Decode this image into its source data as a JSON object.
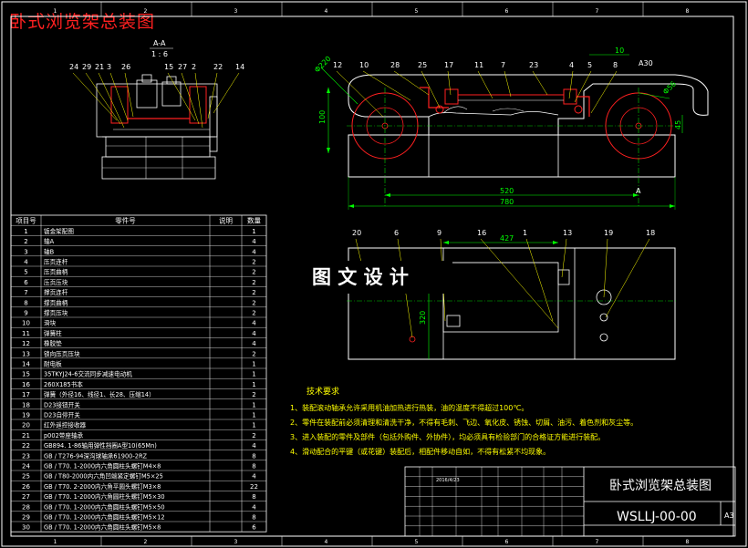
{
  "header_title": "卧式浏览架总装图",
  "border_zones_top": [
    "1",
    "2",
    "3",
    "4",
    "5",
    "6",
    "7",
    "8"
  ],
  "section_label": "A-A",
  "section_scale": "1 : 6",
  "left_callouts": [
    "24",
    "29",
    "21",
    "3",
    "26",
    "15",
    "27",
    "2",
    "22",
    "14"
  ],
  "top_callouts": [
    "12",
    "10",
    "28",
    "25",
    "17",
    "11",
    "7",
    "23",
    "4",
    "5",
    "8"
  ],
  "view_label_a": "A",
  "view_label_a30": "A30",
  "dims_top": {
    "d220": "Φ220",
    "d100": "100",
    "d10": "10",
    "d56": "Φ56",
    "d45": "45",
    "d520": "520",
    "d780": "780"
  },
  "bottom_callouts": [
    "20",
    "6",
    "9",
    "16",
    "1",
    "13",
    "19",
    "18"
  ],
  "dims_bottom": {
    "d427": "427",
    "d320": "320"
  },
  "watermark": "图 文 设 计",
  "bom_header": [
    "项目号",
    "零件号",
    "说明",
    "数量"
  ],
  "bom_rows": [
    [
      "1",
      "钣金架配图",
      "",
      "1"
    ],
    [
      "2",
      "轴A",
      "",
      "4"
    ],
    [
      "3",
      "轴B",
      "",
      "4"
    ],
    [
      "4",
      "压页连杆",
      "",
      "2"
    ],
    [
      "5",
      "压页曲柄",
      "",
      "2"
    ],
    [
      "6",
      "压页压块",
      "",
      "2"
    ],
    [
      "7",
      "撑页连杆",
      "",
      "2"
    ],
    [
      "8",
      "撑页曲柄",
      "",
      "2"
    ],
    [
      "9",
      "撑页压块",
      "",
      "2"
    ],
    [
      "10",
      "滑块",
      "",
      "4"
    ],
    [
      "11",
      "弹簧柱",
      "",
      "4"
    ],
    [
      "12",
      "橡胶垫",
      "",
      "4"
    ],
    [
      "13",
      "锁向压页压块",
      "",
      "2"
    ],
    [
      "14",
      "耐电板",
      "",
      "1"
    ],
    [
      "15",
      "35TKYJ24-6交流同步减速电动机",
      "",
      "1"
    ],
    [
      "16",
      "260X185书本",
      "",
      "1"
    ],
    [
      "17",
      "弹簧（外径16、线径1、长28、压缩14）",
      "",
      "2"
    ],
    [
      "18",
      "D23接钮开关",
      "",
      "1"
    ],
    [
      "19",
      "D23自停开关",
      "",
      "1"
    ],
    [
      "20",
      "红外遥控接收器",
      "",
      "1"
    ],
    [
      "21",
      "p002带座轴承",
      "",
      "2"
    ],
    [
      "22",
      "GB894. 1-86轴用弹性挡圈A型10(65Mn)",
      "",
      "4"
    ],
    [
      "23",
      "GB / T276-94深沟球轴承61900-2RZ",
      "",
      "8"
    ],
    [
      "24",
      "GB / T70. 1-2000内六角圆柱头螺钉M4×8",
      "",
      "8"
    ],
    [
      "25",
      "GB / T80-2000内六角凹端紧定螺钉M5×25",
      "",
      "4"
    ],
    [
      "26",
      "GB / T70. 2-2000内六角平圆头螺钉M3×8",
      "",
      "22"
    ],
    [
      "27",
      "GB / T70. 1-2000内六角圆柱头螺钉M5×30",
      "",
      "8"
    ],
    [
      "28",
      "GB / T70. 1-2000内六角圆柱头螺钉M5×50",
      "",
      "4"
    ],
    [
      "29",
      "GB / T70. 1-2000内六角圆柱头螺钉M5×12",
      "",
      "8"
    ],
    [
      "30",
      "GB / T70. 1-2000内六角圆柱头螺钉M5×8",
      "",
      "6"
    ]
  ],
  "tech_title": "技术要求",
  "tech_lines": [
    "1、装配滚动轴承允许采用机油加热进行热装，油的温度不得超过100℃。",
    "2、零件在装配前必须清理和清洗干净，不得有毛刺、飞边、氧化皮、锈蚀、切屑、油污、着色剂和灰尘等。",
    "3、进入装配的零件及部件（包括外购件、外协件），均必须具有检验部门的合格证方能进行装配。",
    "4、滑动配合的平键（或花键）装配后，相配件移动自如，不得有松紧不均现象。"
  ],
  "title_block": {
    "drawing_name": "卧式浏览架总装图",
    "drawing_no": "WSLLJ-00-00",
    "sheet_size": "A3",
    "date": "2016/4/23"
  },
  "colors": {
    "background": "#000000",
    "line": "#ffffff",
    "part_red": "#ff2020",
    "dimension_green": "#00ff00",
    "callout_yellow": "#ffff00",
    "text_yellow": "#ffff00"
  }
}
